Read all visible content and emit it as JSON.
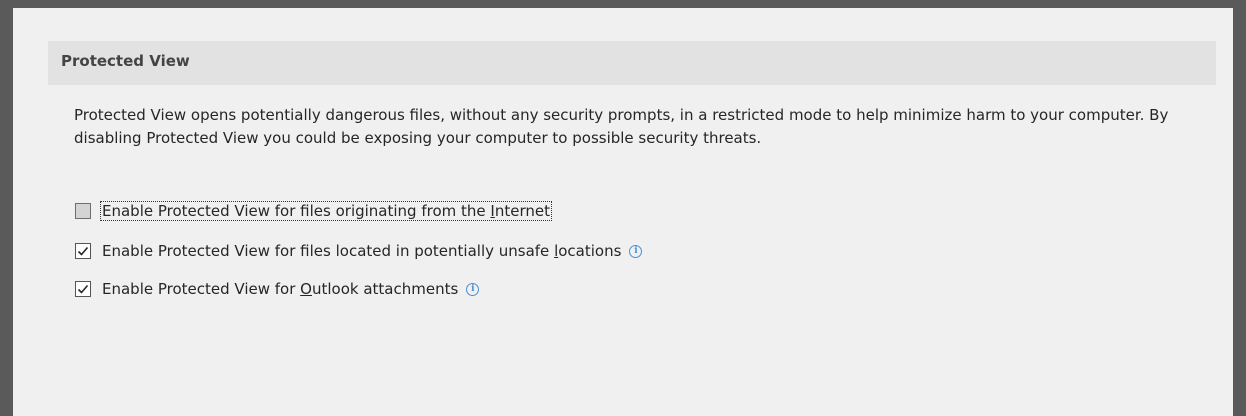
{
  "section": {
    "title": "Protected View"
  },
  "description": "Protected View opens potentially dangerous files, without any security prompts, in a restricted mode to help minimize harm to your computer. By disabling Protected View you could be exposing your computer to possible security threats.",
  "options": [
    {
      "label_before": "Enable Protected View for files originating from the ",
      "mnemonic": "I",
      "label_after": "nternet",
      "checked": false,
      "focused": true,
      "info_icon": false
    },
    {
      "label_before": "Enable Protected View for files located in potentially unsafe ",
      "mnemonic": "l",
      "label_after": "ocations",
      "checked": true,
      "focused": false,
      "info_icon": true
    },
    {
      "label_before": "Enable Protected View for ",
      "mnemonic": "O",
      "label_after": "utlook attachments",
      "checked": true,
      "focused": false,
      "info_icon": true
    }
  ],
  "icons": {
    "info": "info-icon",
    "info_glyph": "i",
    "check": "checkmark-icon"
  },
  "colors": {
    "frame": "#5a5a5a",
    "background": "#f0f0f0",
    "header_bar": "#e2e2e2",
    "info_blue": "#4a8fd8"
  }
}
